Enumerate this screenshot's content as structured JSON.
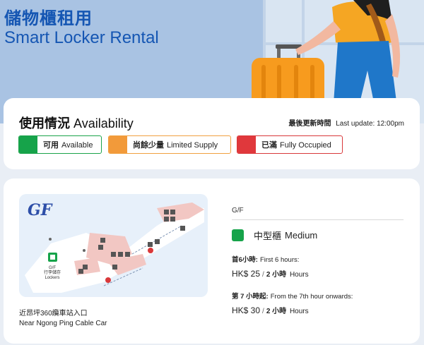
{
  "hero": {
    "title_zh": "儲物櫃租用",
    "title_en": "Smart Locker Rental"
  },
  "availability": {
    "title_zh": "使用情況",
    "title_en": "Availability",
    "last_update_label": "最後更新時間",
    "last_update_value": "Last update: 12:00pm",
    "legend": [
      {
        "zh": "可用",
        "en": "Available",
        "color": "#16a34a"
      },
      {
        "zh": "尚餘少量",
        "en": "Limited Supply",
        "color": "#f29a3a"
      },
      {
        "zh": "已滿",
        "en": "Fully Occupied",
        "color": "#e0383c"
      }
    ]
  },
  "location": {
    "map_floor_badge": "GF",
    "map_locker_label_zh": "G/F\n行李儲存",
    "map_locker_label_en": "Lockers",
    "caption_zh": "近昂坪360纜車站入口",
    "caption_en": "Near Ngong Ping Cable Car",
    "floor": "G/F",
    "size": {
      "zh": "中型櫃",
      "en": "Medium",
      "status_color": "#16a34a"
    },
    "rates": [
      {
        "label_zh": "首6小時:",
        "label_en": "First 6 hours:",
        "price": "HK$ 25",
        "unit_zh": "2 小時",
        "unit_en": "Hours"
      },
      {
        "label_zh": "第 7 小時起:",
        "label_en": "From the 7th hour onwards:",
        "price": "HK$ 30",
        "unit_zh": "2 小時",
        "unit_en": "Hours"
      }
    ]
  }
}
